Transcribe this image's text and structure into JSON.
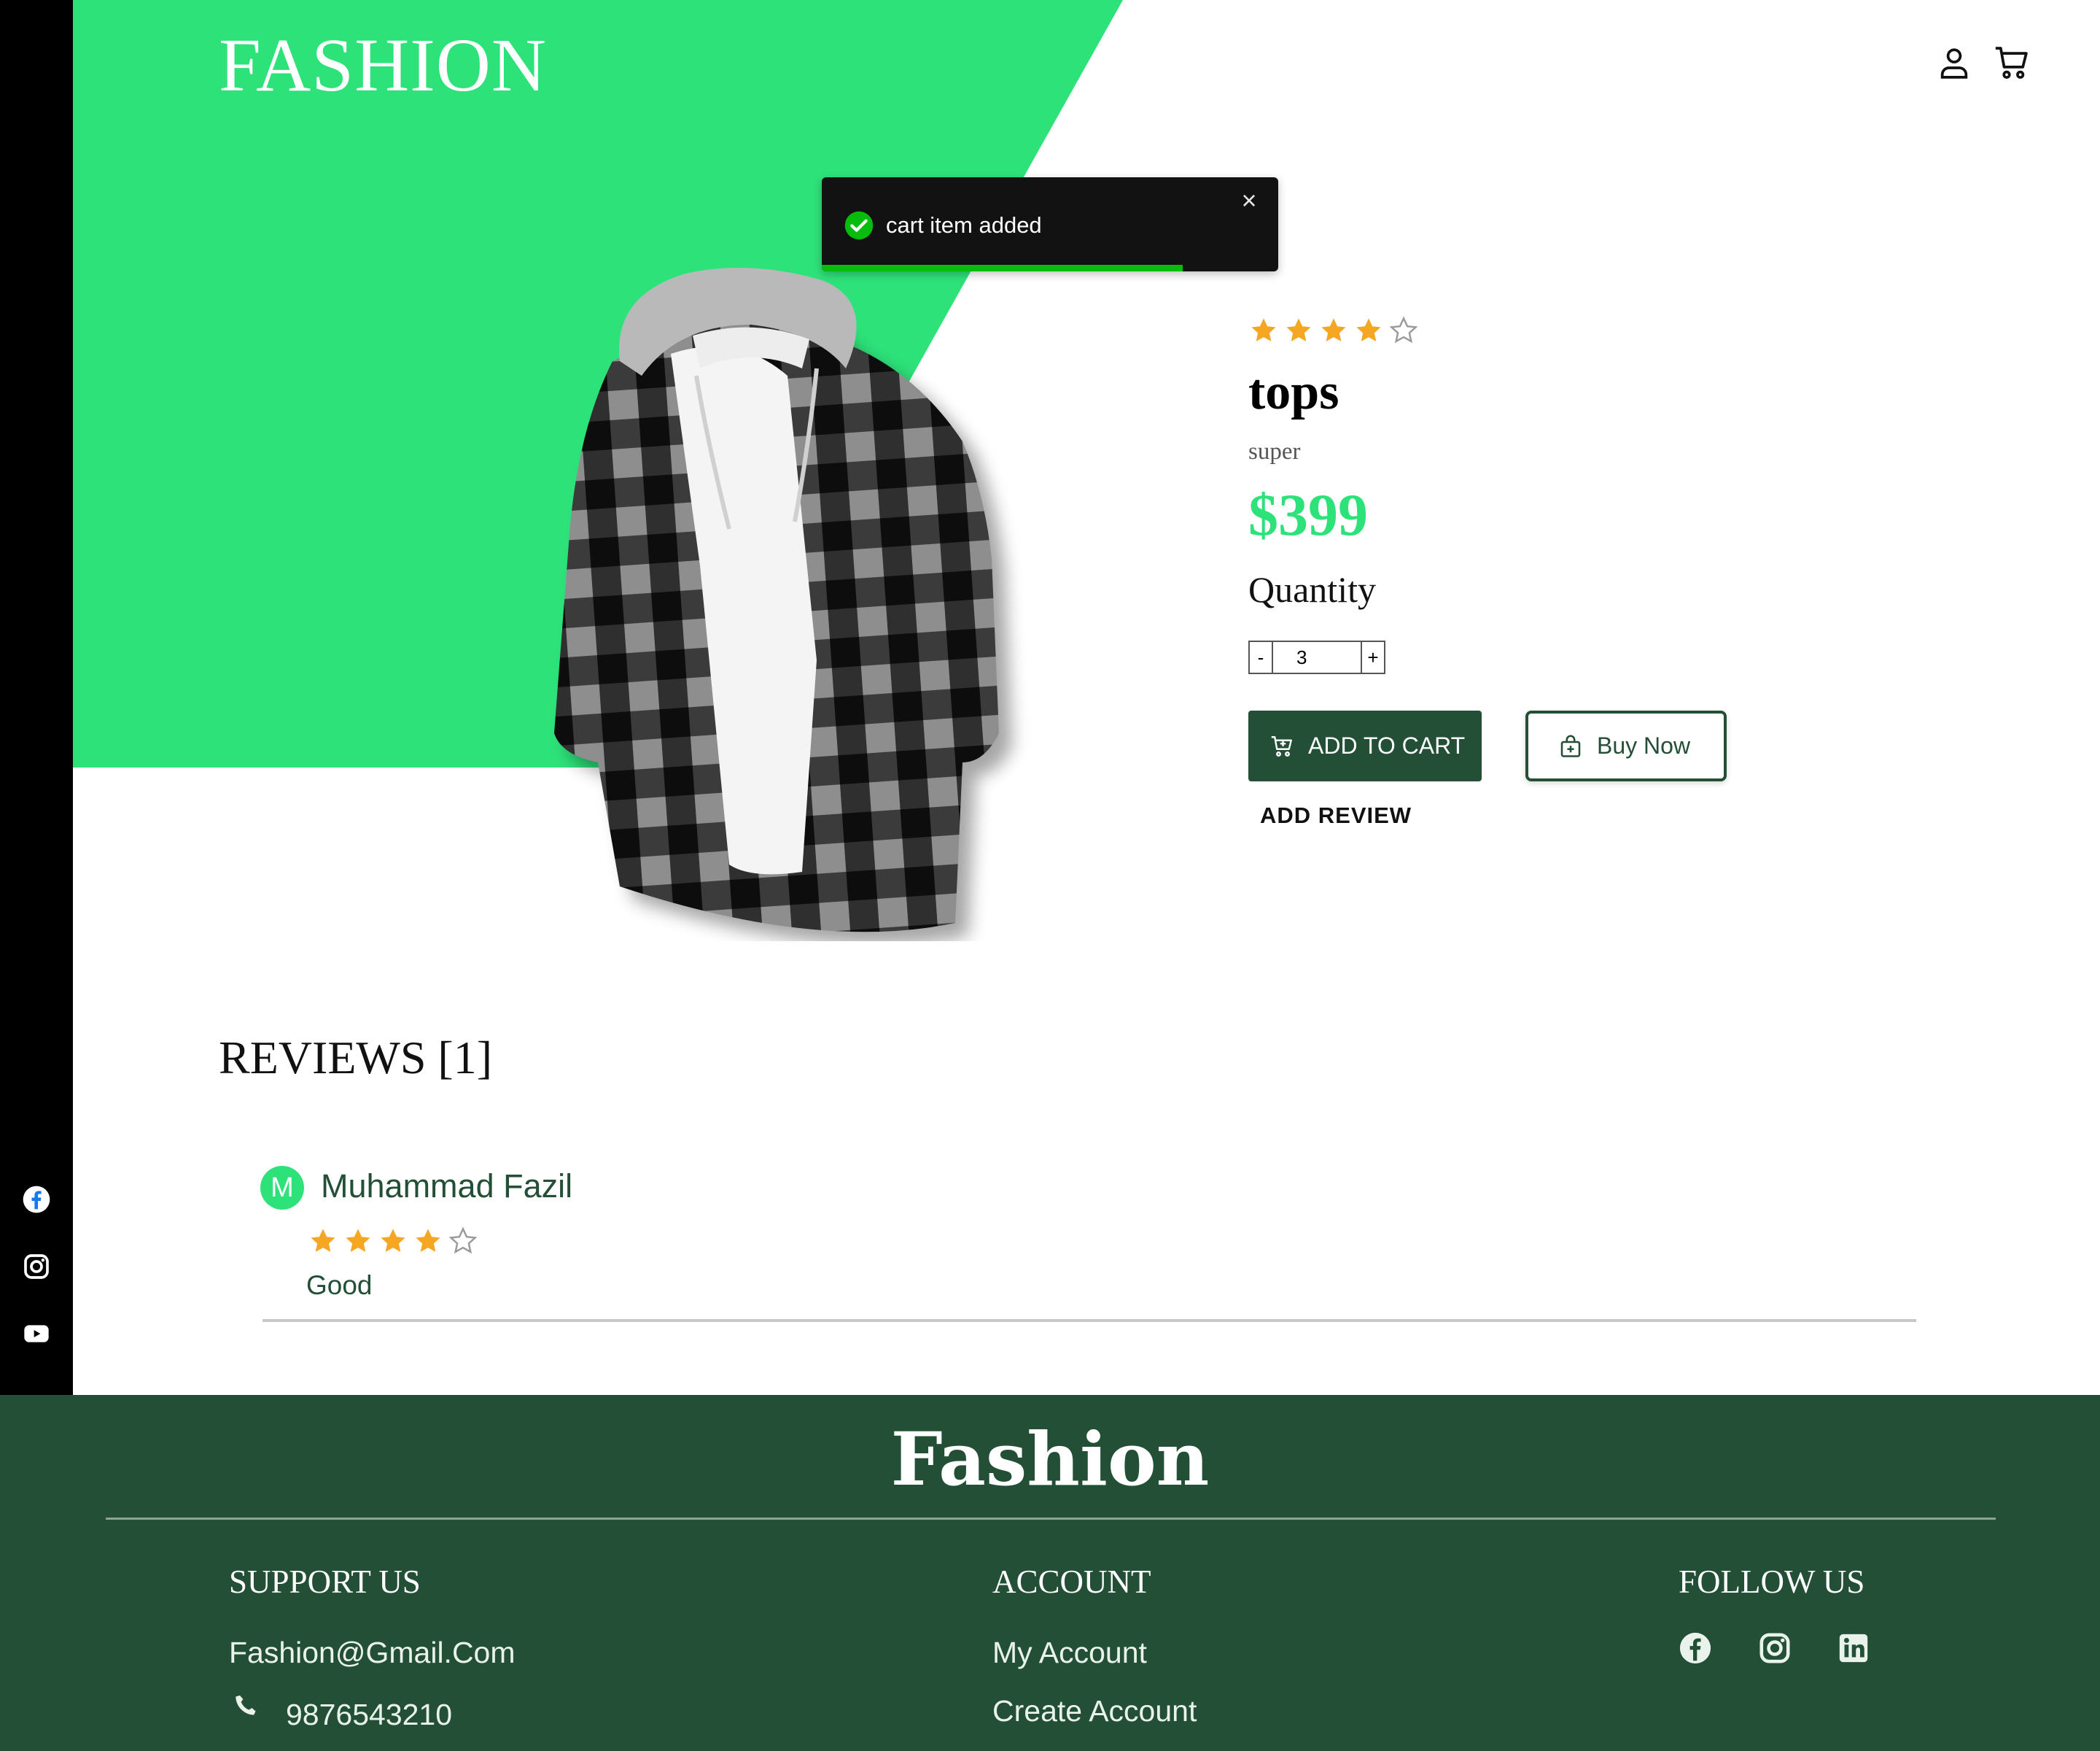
{
  "colors": {
    "accent_green": "#2ee27a",
    "dark_green": "#224f35",
    "star_gold": "#f5a623",
    "toast_bg": "#121212",
    "toast_progress": "#07bc0c"
  },
  "header": {
    "logo": "FASHION",
    "icons": [
      "user-icon",
      "cart-icon"
    ]
  },
  "sidebar": {
    "icons": [
      "facebook-icon",
      "instagram-icon",
      "youtube-icon"
    ]
  },
  "toast": {
    "message": "cart item added",
    "close_symbol": "×",
    "progress": 0.79
  },
  "product": {
    "image_alt": "plaid hooded shirt",
    "rating": 4,
    "rating_max": 5,
    "name": "tops",
    "description": "super",
    "price": "$399",
    "quantity_label": "Quantity",
    "quantity": "3",
    "decrement_label": "-",
    "increment_label": "+",
    "add_to_cart_label": "ADD TO CART",
    "buy_now_label": "Buy Now",
    "add_review_label": "ADD REVIEW"
  },
  "reviews": {
    "title": "REVIEWS [1]",
    "items": [
      {
        "avatar_letter": "M",
        "name": "Muhammad Fazil",
        "rating": 4,
        "text": "Good"
      }
    ]
  },
  "footer": {
    "logo": "Fashion",
    "support": {
      "heading": "SUPPORT US",
      "email": "Fashion@Gmail.Com",
      "phone": "9876543210"
    },
    "account": {
      "heading": "ACCOUNT",
      "links": [
        "My Account",
        "Create Account"
      ]
    },
    "follow": {
      "heading": "FOLLOW US",
      "icons": [
        "facebook-icon",
        "instagram-icon",
        "linkedin-icon"
      ]
    }
  }
}
